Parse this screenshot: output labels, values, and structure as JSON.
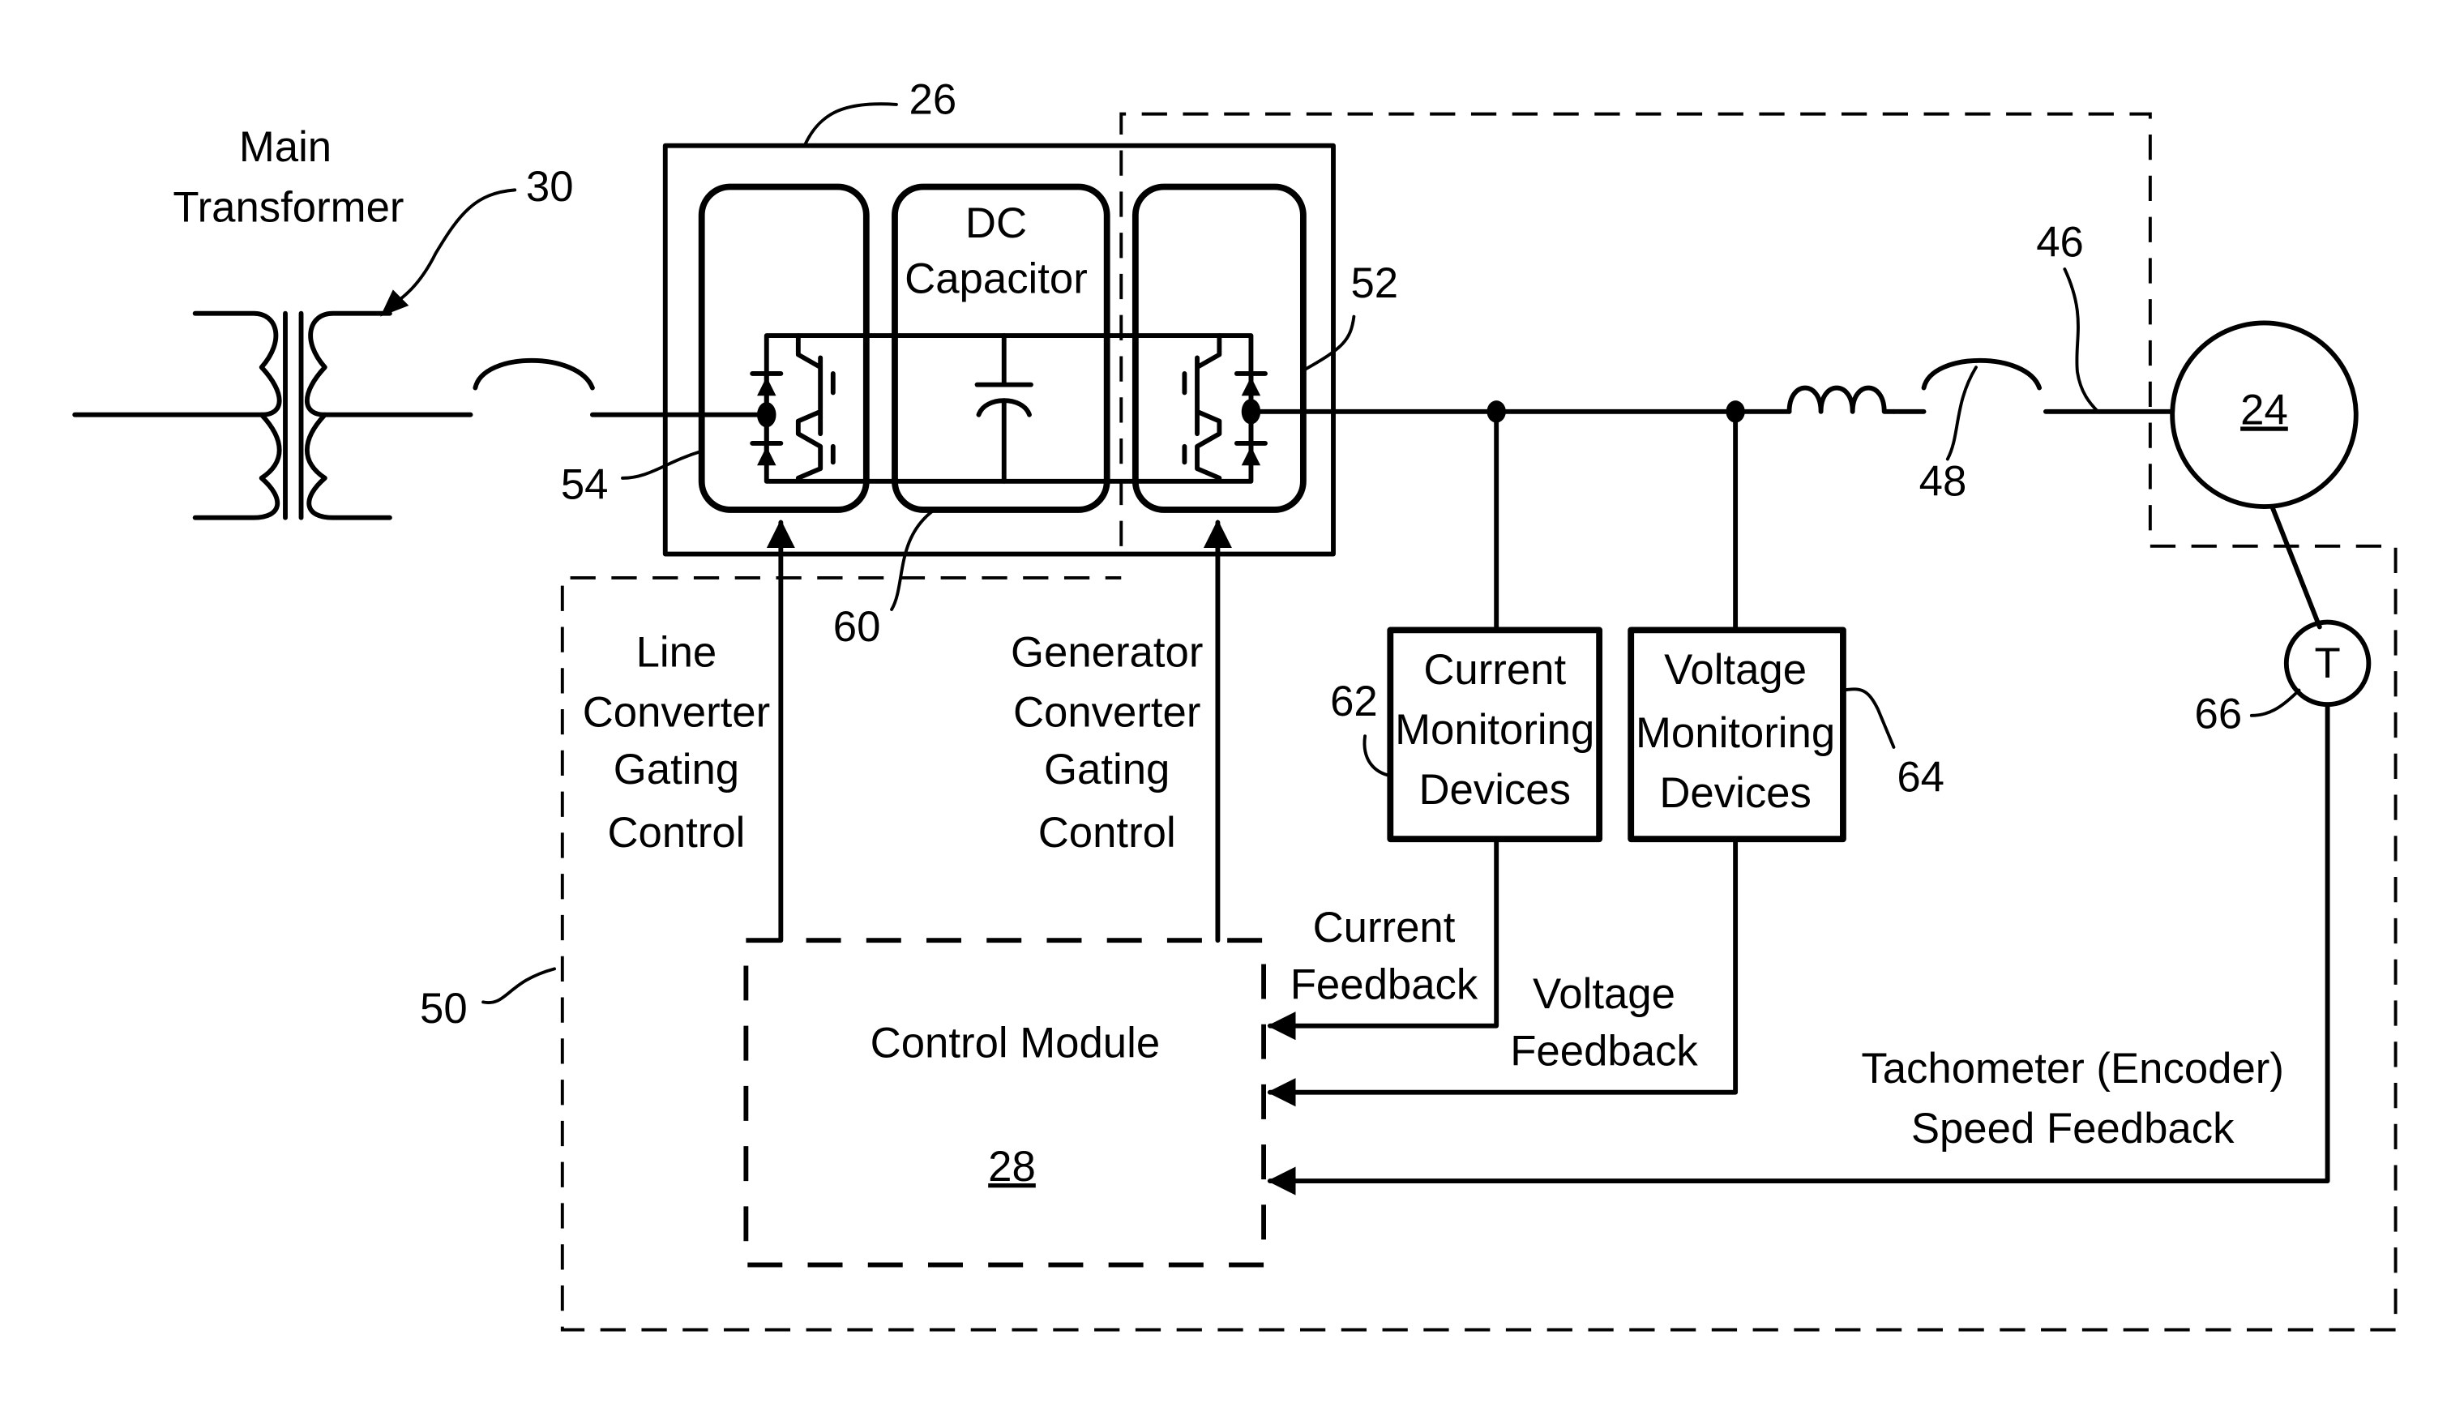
{
  "figure": {
    "type": "block-diagram",
    "subject": "power converter system with control module"
  },
  "components": {
    "main_transformer": {
      "label_line1": "Main",
      "label_line2": "Transformer",
      "ref": "30"
    },
    "power_converter": {
      "ref": "26"
    },
    "line_converter": {
      "ref": "54"
    },
    "dc_link": {
      "label_line1": "DC",
      "label_line2": "Capacitor",
      "ref": "60"
    },
    "generator_converter": {
      "ref": "52"
    },
    "line_conductor": {
      "ref": "46"
    },
    "breaker": {
      "ref": "48"
    },
    "generator": {
      "ref": "24"
    },
    "tachometer": {
      "symbol": "T",
      "ref": "66"
    },
    "current_monitoring": {
      "line1": "Current",
      "line2": "Monitoring",
      "line3": "Devices",
      "ref": "62"
    },
    "voltage_monitoring": {
      "line1": "Voltage",
      "line2": "Monitoring",
      "line3": "Devices",
      "ref": "64"
    },
    "control_module": {
      "label": "Control Module",
      "ref": "28"
    },
    "control_system": {
      "ref": "50"
    }
  },
  "signals": {
    "line_gating": {
      "line1": "Line",
      "line2": "Converter",
      "line3": "Gating",
      "line4": "Control"
    },
    "generator_gating": {
      "line1": "Generator",
      "line2": "Converter",
      "line3": "Gating",
      "line4": "Control"
    },
    "current_feedback": {
      "line1": "Current",
      "line2": "Feedback"
    },
    "voltage_feedback": {
      "line1": "Voltage",
      "line2": "Feedback"
    },
    "speed_feedback": {
      "line1": "Tachometer (Encoder)",
      "line2": "Speed Feedback"
    }
  }
}
